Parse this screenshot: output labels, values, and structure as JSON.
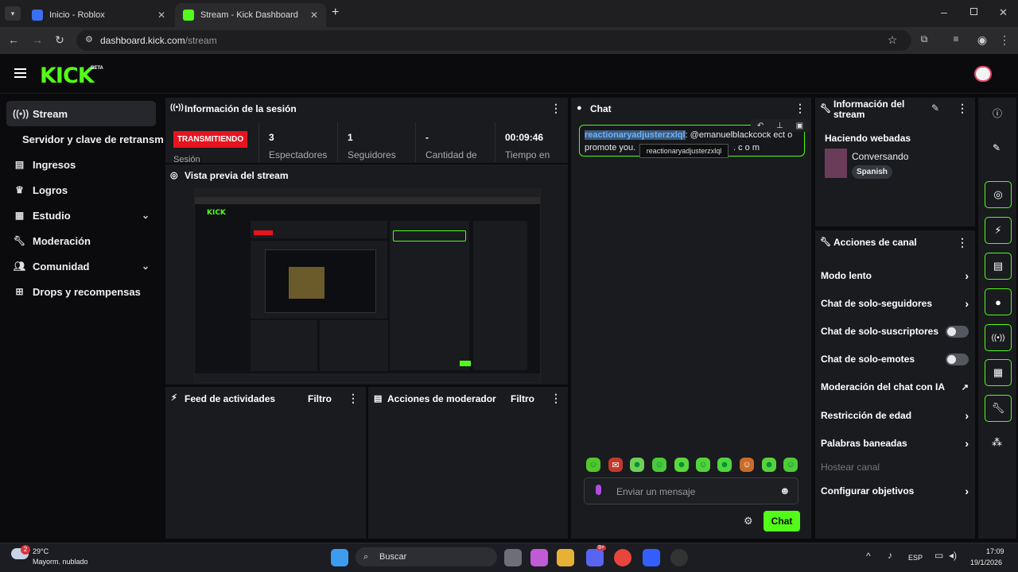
{
  "browser": {
    "tabs": [
      {
        "title": "Inicio - Roblox",
        "active": false
      },
      {
        "title": "Stream - Kick Dashboard",
        "active": true
      }
    ],
    "url_host": "dashboard.kick.com",
    "url_path": "/stream",
    "new_tab": "+"
  },
  "kick": {
    "logo": "KICK",
    "beta": "BETA"
  },
  "sidebar": {
    "items": [
      {
        "label": "Stream",
        "icon": "broadcast-icon"
      },
      {
        "label": "Servidor y clave de retransm"
      },
      {
        "label": "Ingresos",
        "icon": "chart-icon"
      },
      {
        "label": "Logros",
        "icon": "trophy-icon"
      },
      {
        "label": "Estudio",
        "icon": "studio-icon"
      },
      {
        "label": "Moderación",
        "icon": "wrench-icon"
      },
      {
        "label": "Comunidad",
        "icon": "people-icon"
      },
      {
        "label": "Drops y recompensas",
        "icon": "gift-icon"
      }
    ]
  },
  "session": {
    "title": "Información de la sesión",
    "status_badge": "TRANSMITIENDO",
    "stats": [
      {
        "value": "3",
        "label": "Espectadores"
      },
      {
        "value": "1",
        "label": "Seguidores"
      },
      {
        "value": "-",
        "label": "Cantidad de"
      },
      {
        "value": "00:09:46",
        "label": "Tiempo en"
      }
    ],
    "session_label_fragment": "Sesión"
  },
  "preview": {
    "title": "Vista previa del stream"
  },
  "activity_feed": {
    "title": "Feed de actividades",
    "filter": "Filtro"
  },
  "mod_actions": {
    "title": "Acciones de moderador",
    "filter": "Filtro"
  },
  "chat": {
    "title": "Chat",
    "pinned_user": "reactionaryadjusterzxlql",
    "pinned_text": ": @emanuelblackcock ect o",
    "pinned_text2": "promote you.",
    "pinned_text3": ". c o m",
    "tooltip": "reactionaryadjusterzxlql",
    "input_placeholder": "Enviar un mensaje",
    "send_label": "Chat"
  },
  "stream_info": {
    "title_line1": "Información del",
    "title_line2": "stream",
    "stream_title": "Haciendo webadas",
    "category": "Conversando",
    "language": "Spanish"
  },
  "channel_actions": {
    "title": "Acciones de canal",
    "rows": [
      {
        "label": "Modo lento",
        "control": "arrow"
      },
      {
        "label": "Chat de solo-seguidores",
        "control": "arrow"
      },
      {
        "label": "Chat de solo-suscriptores",
        "control": "toggle"
      },
      {
        "label": "Chat de solo-emotes",
        "control": "toggle"
      },
      {
        "label": "Moderación del chat con IA",
        "control": "external"
      },
      {
        "label": "Restricción de edad",
        "control": "arrow"
      },
      {
        "label": "Palabras baneadas",
        "control": "arrow"
      },
      {
        "label": "Hostear canal",
        "control": "none"
      },
      {
        "label": "Configurar objetivos",
        "control": "arrow"
      }
    ]
  },
  "taskbar": {
    "weather_temp": "29°C",
    "weather_desc": "Mayorm. nublado",
    "weather_badge": "2",
    "search_label": "Buscar",
    "lang": "ESP",
    "time": "17:09",
    "date": "19/1/2026",
    "discord_badge": "9+"
  },
  "colors": {
    "accent": "#53fc18",
    "danger": "#e5141f",
    "panel": "#191b1f"
  }
}
